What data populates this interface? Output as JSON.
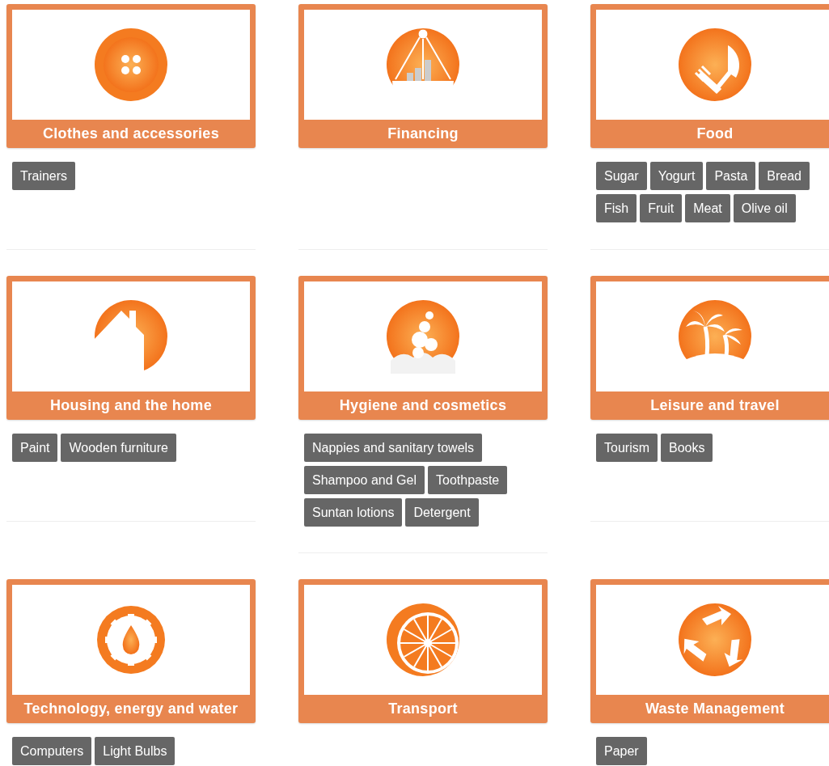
{
  "categories": [
    {
      "title": "Clothes and accessories",
      "tags": [
        "Trainers"
      ]
    },
    {
      "title": "Financing"
    },
    {
      "title": "Food",
      "tags": [
        "Sugar",
        "Yogurt",
        "Pasta",
        "Bread",
        "Fish",
        "Fruit",
        "Meat",
        "Olive oil"
      ]
    },
    {
      "title": "Housing and the home",
      "tags": [
        "Paint",
        "Wooden furniture"
      ]
    },
    {
      "title": "Hygiene and cosmetics",
      "tags": [
        "Nappies and sanitary towels",
        "Shampoo and Gel",
        "Toothpaste",
        "Suntan lotions",
        "Detergent"
      ]
    },
    {
      "title": "Leisure and travel",
      "tags": [
        "Tourism",
        "Books"
      ]
    },
    {
      "title": "Technology, energy and water",
      "tags": [
        "Computers",
        "Light Bulbs"
      ]
    },
    {
      "title": "Transport"
    },
    {
      "title": "Waste Management",
      "tags": [
        "Paper"
      ]
    }
  ]
}
